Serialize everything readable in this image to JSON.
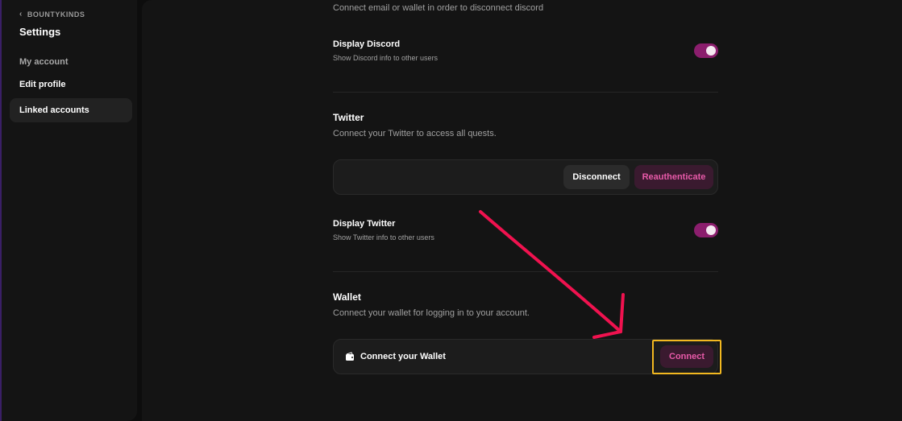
{
  "sidebar": {
    "back_label": "BOUNTYKINDS",
    "title": "Settings",
    "items": [
      {
        "label": "My account"
      },
      {
        "label": "Edit profile"
      },
      {
        "label": "Linked accounts"
      }
    ]
  },
  "discord": {
    "connect_hint": "Connect email or wallet in order to disconnect discord",
    "display_label": "Display Discord",
    "display_desc": "Show Discord info to other users"
  },
  "twitter": {
    "title": "Twitter",
    "desc": "Connect your Twitter to access all quests.",
    "disconnect_label": "Disconnect",
    "reauth_label": "Reauthenticate",
    "display_label": "Display Twitter",
    "display_desc": "Show Twitter info to other users"
  },
  "wallet": {
    "title": "Wallet",
    "desc": "Connect your wallet for logging in to your account.",
    "connect_wallet_label": "Connect your Wallet",
    "connect_button_label": "Connect",
    "icon": "wallet-icon"
  },
  "colors": {
    "accent_pink": "#e85aa9",
    "toggle_on": "#8b1e6d",
    "highlight": "#f2b820",
    "annotation_arrow": "#f0124f"
  }
}
